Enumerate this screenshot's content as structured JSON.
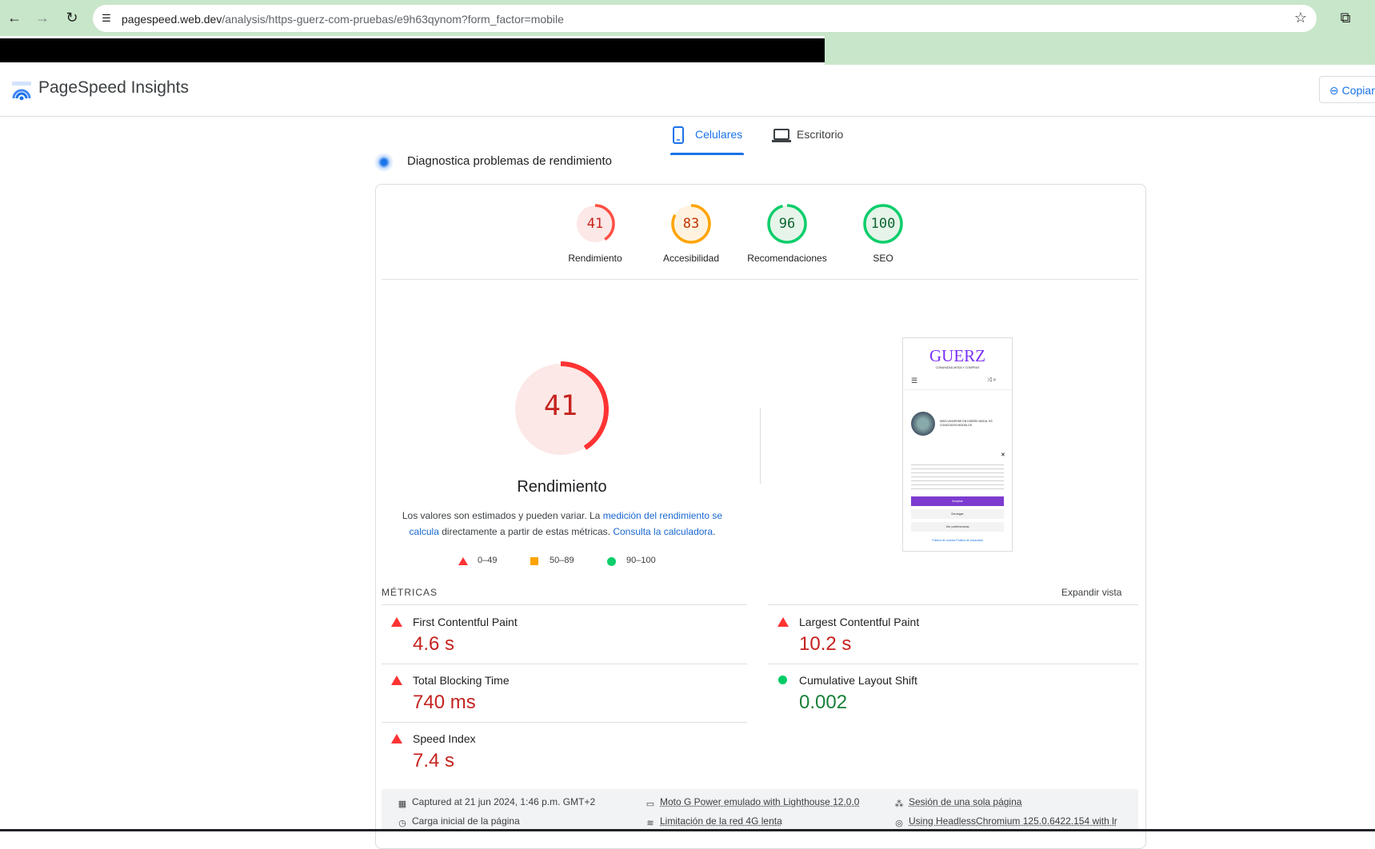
{
  "browser": {
    "url_host": "pagespeed.web.dev",
    "url_path": "/analysis/https-guerz-com-pruebas/e9h63qynom?form_factor=mobile"
  },
  "header": {
    "title": "PageSpeed Insights",
    "copy_label": "Copiar"
  },
  "tabs": {
    "mobile": "Celulares",
    "desktop": "Escritorio"
  },
  "diagnostic_title": "Diagnostica problemas de rendimiento",
  "scores": [
    {
      "value": "41",
      "label": "Rendimiento",
      "color": "#ff4e42",
      "bg": "#fce8e6",
      "text_color": "#c5221f",
      "fraction": 0.41
    },
    {
      "value": "83",
      "label": "Accesibilidad",
      "color": "#ffa400",
      "bg": "#fff3e0",
      "text_color": "#c33300",
      "fraction": 0.83
    },
    {
      "value": "96",
      "label": "Recomendaciones",
      "color": "#0cce6b",
      "bg": "#e6f4ea",
      "text_color": "#0d652d",
      "fraction": 0.96
    },
    {
      "value": "100",
      "label": "SEO",
      "color": "#0cce6b",
      "bg": "#e6f4ea",
      "text_color": "#0d652d",
      "fraction": 1.0
    }
  ],
  "performance": {
    "score": "41",
    "fraction": 0.41,
    "title": "Rendimiento",
    "desc_1": "Los valores son estimados y pueden variar. La ",
    "desc_link_1": "medición del rendimiento se calcula",
    "desc_2": " directamente a partir de estas métricas. ",
    "desc_link_2": "Consulta la calculadora",
    "desc_3": "."
  },
  "legend": {
    "poor": "0–49",
    "average": "50–89",
    "good": "90–100"
  },
  "screenshot": {
    "brand": "GUERZ",
    "tagline": "COMUNIDAD,MODA Y COMPRAS",
    "post_title": "MISS UNIVERSE EN DISEÑO MODA, ES CONOCIDOS MODELOS",
    "accept": "Aceptar",
    "deny": "Denegar",
    "prefs": "Ver preferencias",
    "links": "Política de cookies   Política de privacidad"
  },
  "metrics_heading": "MÉTRICAS",
  "expand_label": "Expandir vista",
  "metrics": {
    "fcp": {
      "name": "First Contentful Paint",
      "value": "4.6 s"
    },
    "lcp": {
      "name": "Largest Contentful Paint",
      "value": "10.2 s"
    },
    "tbt": {
      "name": "Total Blocking Time",
      "value": "740 ms"
    },
    "cls": {
      "name": "Cumulative Layout Shift",
      "value": "0.002"
    },
    "si": {
      "name": "Speed Index",
      "value": "7.4 s"
    }
  },
  "footer": {
    "captured": "Captured at 21 jun 2024, 1:46 p.m. GMT+2",
    "initial_load": "Carga inicial de la página",
    "device": "Moto G Power emulado with Lighthouse 12.0.0",
    "network": "Limitación de la red 4G lenta",
    "session": "Sesión de una sola página",
    "browser": "Using HeadlessChromium 125.0.6422.154 with lr"
  }
}
